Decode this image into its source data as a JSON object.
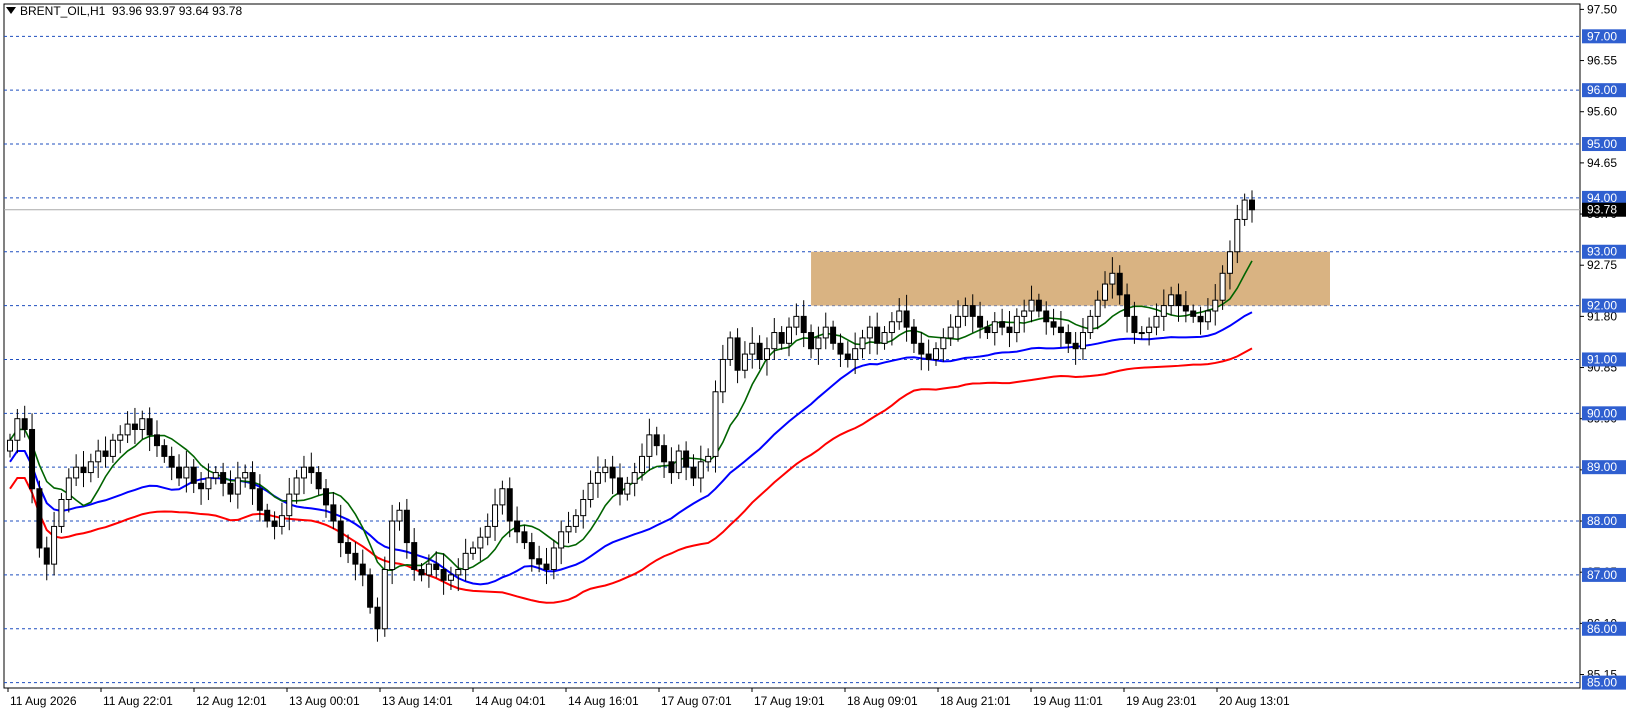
{
  "header": {
    "symbol": "BRENT_OIL,H1",
    "ohlc": "93.96 93.97 93.64 93.78"
  },
  "colors": {
    "background": "#ffffff",
    "grid_level": "#1f4fbf",
    "level_label_bg": "#2f5fd0",
    "current_price_bg": "#000000",
    "zone_fill": "#d9b382",
    "ma_fast": "#006400",
    "ma_mid": "#0000ff",
    "ma_slow": "#ff0000",
    "bull_candle": "#ffffff",
    "bear_candle": "#000000"
  },
  "chart_data": {
    "type": "candlestick",
    "timeframe": "H1",
    "ylim": [
      84.9,
      97.6
    ],
    "price_ticks": [
      "97.50",
      "96.55",
      "95.60",
      "94.65",
      "93.70",
      "92.75",
      "91.80",
      "90.85",
      "89.90",
      "88.95",
      "88.00",
      "87.05",
      "86.10",
      "85.15"
    ],
    "levels": [
      "97.00",
      "96.00",
      "95.00",
      "94.00",
      "93.00",
      "92.00",
      "91.00",
      "90.00",
      "89.00",
      "88.00",
      "87.00",
      "86.00",
      "85.00"
    ],
    "current_price": "93.78",
    "zone": {
      "low": 92.0,
      "high": 93.0
    },
    "time_labels": [
      "11 Aug 2026",
      "11 Aug 22:01",
      "12 Aug 12:01",
      "13 Aug 00:01",
      "13 Aug 14:01",
      "14 Aug 04:01",
      "14 Aug 16:01",
      "17 Aug 07:01",
      "17 Aug 19:01",
      "18 Aug 09:01",
      "18 Aug 21:01",
      "19 Aug 11:01",
      "19 Aug 23:01",
      "20 Aug 13:01"
    ],
    "closes": [
      89.5,
      89.9,
      89.7,
      88.6,
      87.5,
      87.2,
      87.9,
      88.4,
      88.8,
      89.0,
      88.9,
      89.1,
      89.3,
      89.2,
      89.5,
      89.6,
      89.8,
      89.7,
      89.9,
      89.6,
      89.4,
      89.2,
      89.0,
      88.8,
      89.0,
      88.7,
      88.6,
      88.8,
      88.9,
      88.7,
      88.5,
      88.8,
      88.9,
      88.6,
      88.2,
      88.0,
      87.9,
      88.1,
      88.5,
      88.8,
      89.0,
      88.9,
      88.6,
      88.3,
      88.0,
      87.6,
      87.4,
      87.2,
      87.0,
      86.4,
      86.0,
      87.1,
      88.0,
      88.2,
      87.6,
      87.1,
      87.0,
      87.2,
      87.1,
      86.9,
      87.0,
      87.1,
      87.4,
      87.5,
      87.7,
      87.9,
      88.3,
      88.6,
      88.0,
      87.8,
      87.6,
      87.3,
      87.2,
      87.1,
      87.5,
      87.8,
      87.9,
      88.1,
      88.4,
      88.7,
      88.9,
      89.0,
      88.8,
      88.5,
      88.7,
      88.9,
      89.2,
      89.6,
      89.4,
      89.1,
      88.9,
      89.3,
      89.0,
      88.8,
      89.1,
      89.2,
      90.4,
      91.0,
      91.4,
      90.8,
      91.1,
      91.3,
      91.0,
      91.2,
      91.5,
      91.3,
      91.6,
      91.8,
      91.5,
      91.2,
      91.4,
      91.6,
      91.3,
      91.1,
      91.0,
      91.2,
      91.4,
      91.6,
      91.3,
      91.5,
      91.7,
      91.9,
      91.6,
      91.3,
      91.1,
      91.0,
      91.2,
      91.4,
      91.6,
      91.8,
      92.0,
      91.8,
      91.6,
      91.5,
      91.7,
      91.6,
      91.5,
      91.8,
      91.9,
      92.1,
      91.9,
      91.7,
      91.6,
      91.5,
      91.3,
      91.2,
      91.5,
      91.8,
      92.1,
      92.4,
      92.6,
      92.2,
      91.8,
      91.5,
      91.5,
      91.6,
      91.8,
      92.0,
      92.2,
      92.0,
      91.9,
      91.8,
      91.7,
      91.9,
      92.1,
      92.6,
      93.0,
      93.6,
      93.96,
      93.78
    ]
  }
}
